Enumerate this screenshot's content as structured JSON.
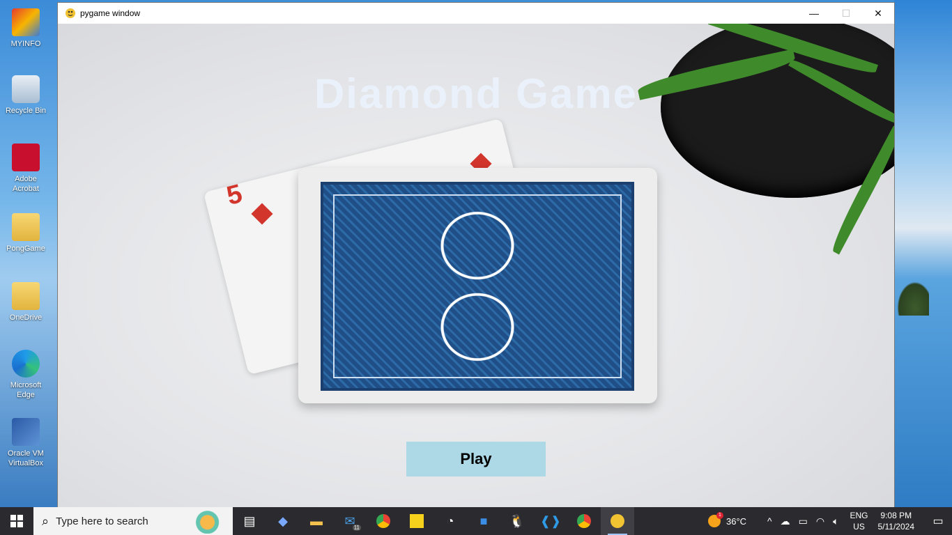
{
  "window": {
    "title": "pygame window",
    "controls": {
      "minimize": "—",
      "maximize": "☐",
      "close": "✕"
    }
  },
  "game": {
    "title": "Diamond Game",
    "play_label": "Play",
    "card_rank": "5"
  },
  "desktop": {
    "icons": [
      {
        "label": "MYINFO",
        "icon": "myinfo-icon"
      },
      {
        "label": "Recycle Bin",
        "icon": "recycle-bin-icon"
      },
      {
        "label": "Adobe Acrobat",
        "icon": "adobe-acrobat-icon"
      },
      {
        "label": "PongGame",
        "icon": "folder-icon"
      },
      {
        "label": "OneDrive",
        "icon": "folder-icon"
      },
      {
        "label": "Microsoft Edge",
        "icon": "edge-icon"
      },
      {
        "label": "Oracle VM VirtualBox",
        "icon": "virtualbox-icon"
      }
    ]
  },
  "taskbar": {
    "search_placeholder": "Type here to search",
    "apps": [
      "task-view",
      "copilot",
      "file-explorer",
      "mail",
      "chrome",
      "sticky-notes",
      "clock-app",
      "store",
      "linux",
      "vscode",
      "chrome-profile",
      "pygame"
    ],
    "mail_badge": "11",
    "weather_temp": "36°C",
    "weather_badge": "1",
    "lang_line1": "ENG",
    "lang_line2": "US",
    "time": "9:08 PM",
    "date": "5/11/2024"
  }
}
